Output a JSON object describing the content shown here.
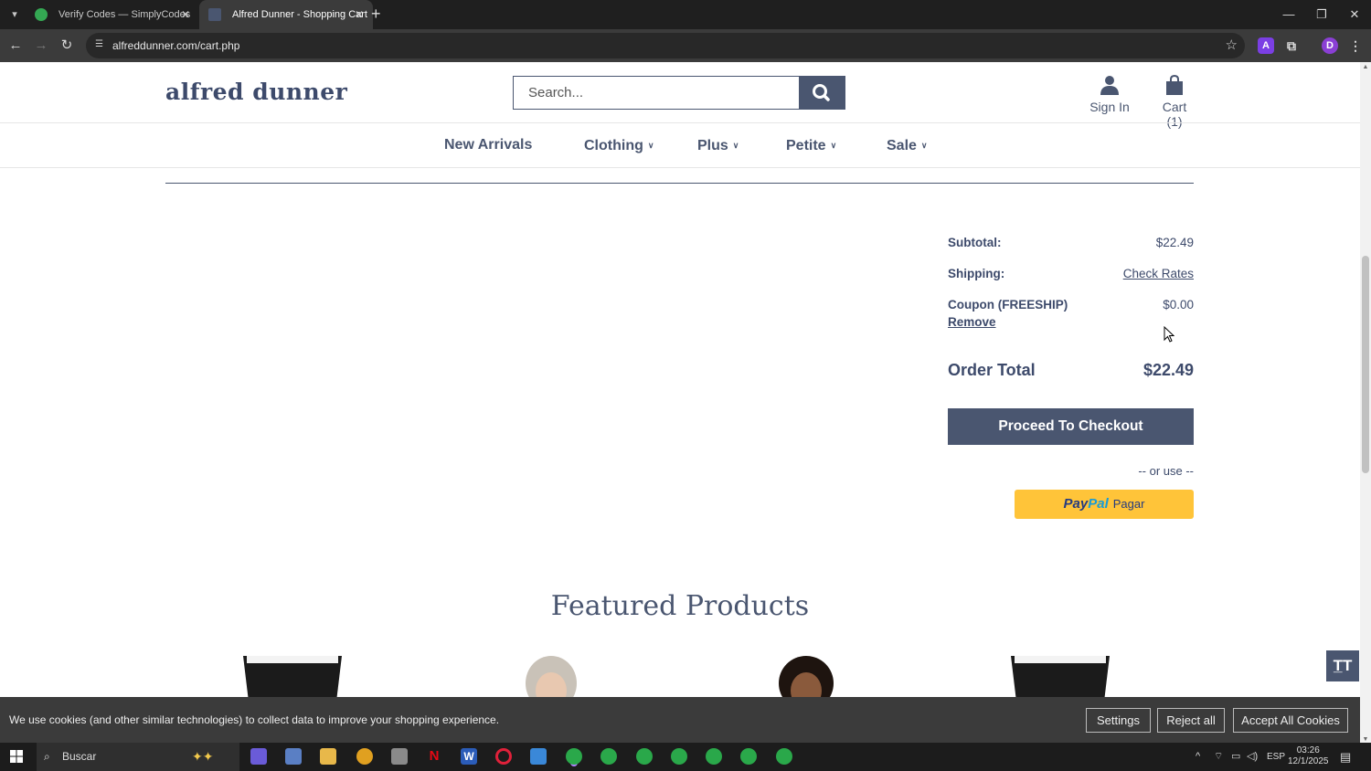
{
  "browser": {
    "tabs": [
      {
        "title": "Verify Codes — SimplyCodes"
      },
      {
        "title": "Alfred Dunner - Shopping Cart"
      }
    ],
    "url": "alfreddunner.com/cart.php",
    "profile_initial": "D"
  },
  "site": {
    "logo": "alfred dunner",
    "search": {
      "placeholder": "Search..."
    },
    "header_actions": {
      "sign_in": "Sign In",
      "cart": "Cart (1)"
    },
    "nav": [
      "New Arrivals",
      "Clothing",
      "Plus",
      "Petite",
      "Sale"
    ]
  },
  "summary": {
    "subtotal_label": "Subtotal:",
    "subtotal_value": "$22.49",
    "shipping_label": "Shipping:",
    "shipping_value": "Check Rates",
    "coupon_label": "Coupon (FREESHIP)",
    "coupon_value": "$0.00",
    "remove_label": "Remove",
    "total_label": "Order Total",
    "total_value": "$22.49",
    "checkout_label": "Proceed To Checkout",
    "or_use": "-- or use --",
    "paypal": {
      "logo_a": "Pay",
      "logo_b": "Pal",
      "text": "Pagar"
    }
  },
  "featured": {
    "title": "Featured Products"
  },
  "cookie": {
    "text": "We use cookies (and other similar technologies) to collect data to improve your shopping experience.",
    "settings": "Settings",
    "reject": "Reject all",
    "accept": "Accept All Cookies"
  },
  "taskbar": {
    "search_label": "Buscar",
    "lang": "ESP",
    "time": "03:26",
    "date": "12/1/2025"
  },
  "colors": {
    "brand": "#4a5670",
    "paypal": "#ffc439",
    "cookie_bg": "#3b3b3b"
  }
}
